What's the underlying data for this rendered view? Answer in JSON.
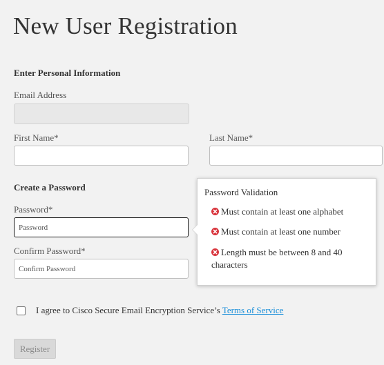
{
  "page": {
    "title": "New User Registration"
  },
  "personal_section": {
    "heading": "Enter Personal Information",
    "email_label": "Email Address",
    "email_value": "",
    "first_name_label": "First Name*",
    "first_name_value": "",
    "last_name_label": "Last Name*",
    "last_name_value": ""
  },
  "password_section": {
    "heading": "Create a Password",
    "password_label": "Password*",
    "password_placeholder": "Password",
    "confirm_label": "Confirm Password*",
    "confirm_placeholder": "Confirm Password"
  },
  "validation_popover": {
    "title": "Password Validation",
    "rules": [
      {
        "text": "Must contain at least one alphabet",
        "status": "failed",
        "icon": "error-circle-x-icon"
      },
      {
        "text": "Must contain at least one number",
        "status": "failed",
        "icon": "error-circle-x-icon"
      },
      {
        "text": "Length must be between 8 and 40 characters",
        "status": "failed",
        "icon": "error-circle-x-icon"
      }
    ]
  },
  "terms": {
    "checked": false,
    "text": "I agree to Cisco Secure Email Encryption Service’s",
    "link_text": "Terms of Service"
  },
  "actions": {
    "register_label": "Register",
    "register_disabled": true
  },
  "colors": {
    "page_background": "#f2f2f2",
    "link": "#1a8fd9",
    "error_icon": "#d9363e",
    "disabled_button": "#d9d9d9"
  }
}
